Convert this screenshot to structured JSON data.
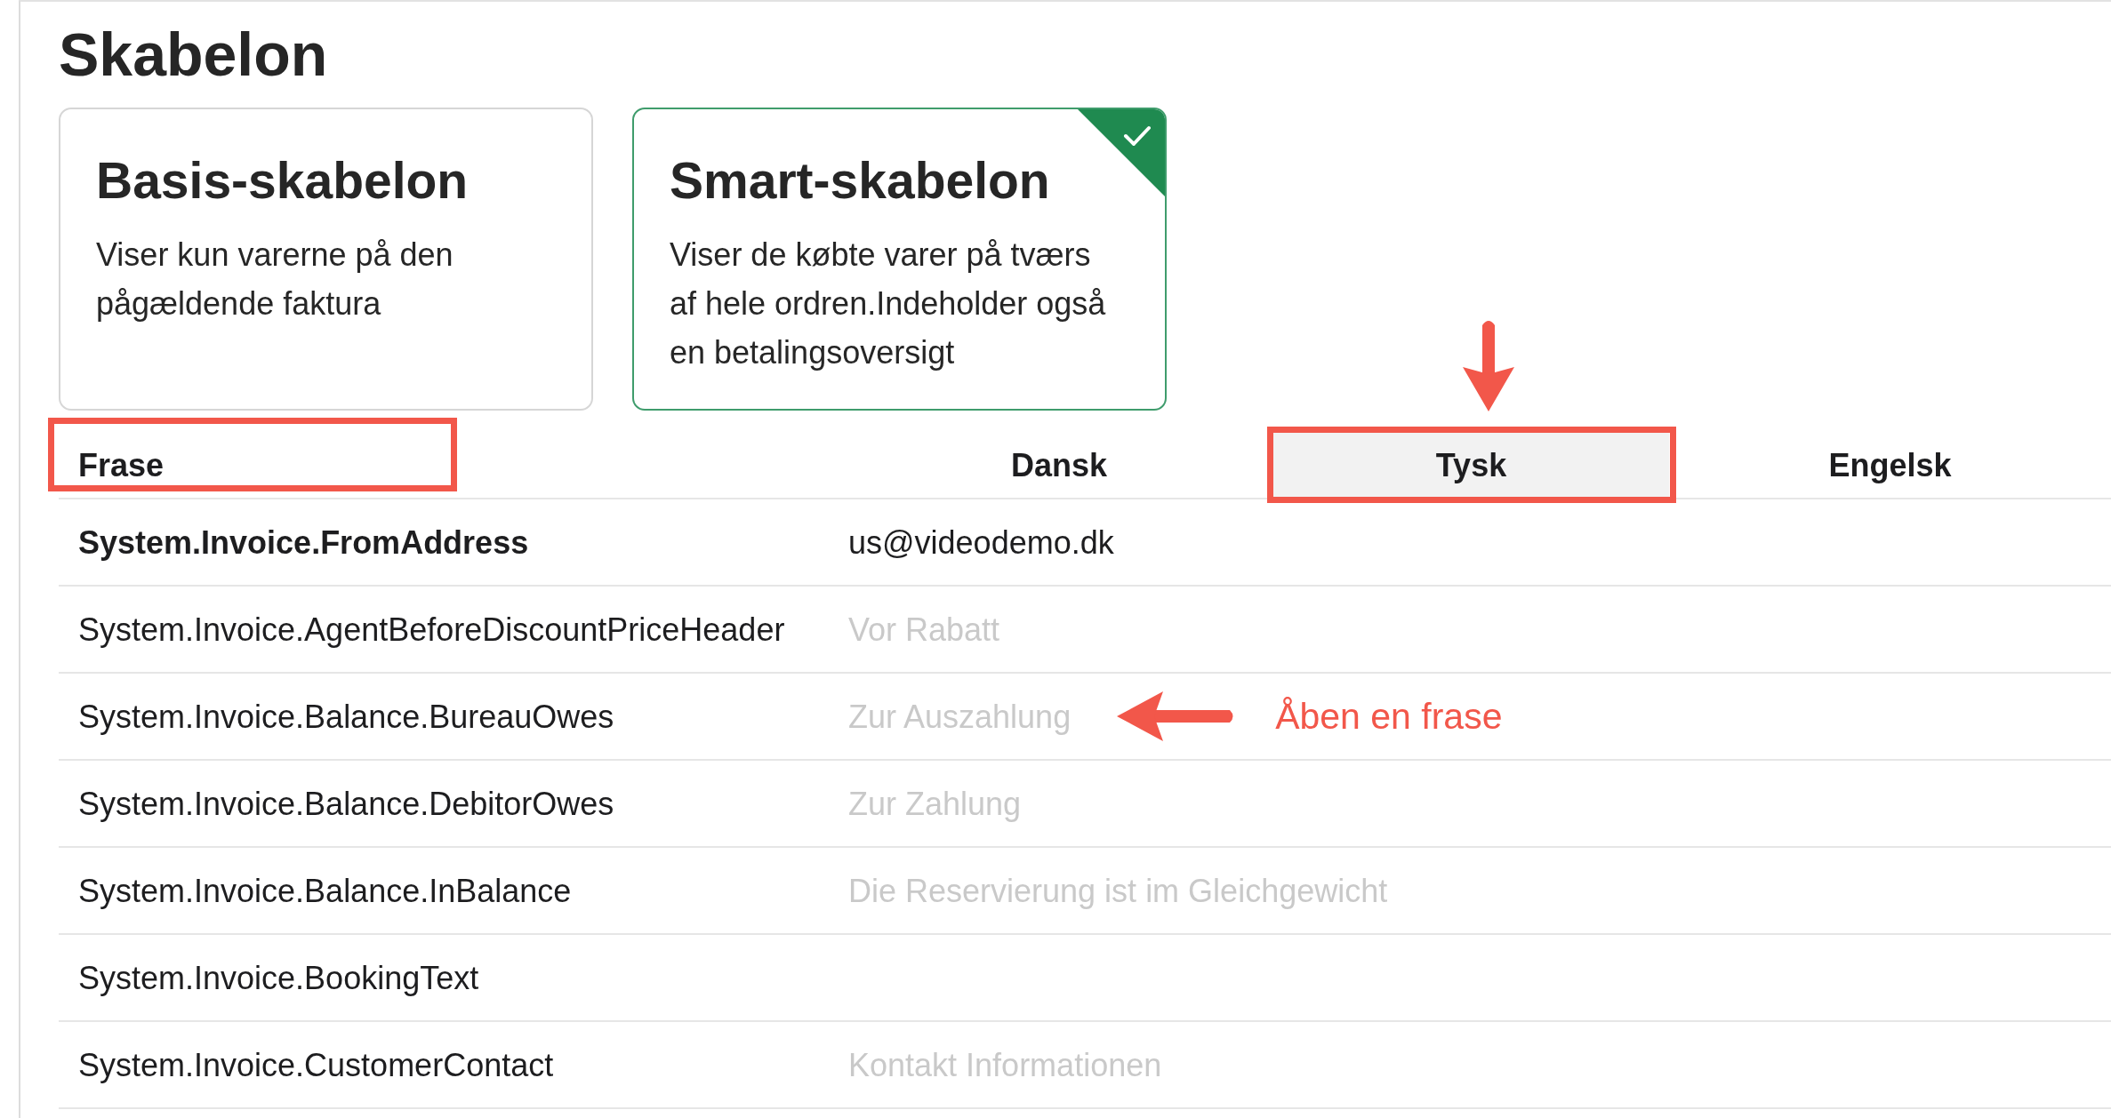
{
  "page": {
    "title": "Skabelon"
  },
  "cards": [
    {
      "title": "Basis-skabelon",
      "description": "Viser kun varerne på den pågældende faktura",
      "selected": false
    },
    {
      "title": "Smart-skabelon",
      "description": "Viser de købte varer på tværs af hele ordren.Indeholder også en betalingsoversigt",
      "selected": true
    }
  ],
  "table": {
    "columns": [
      {
        "label": "Frase",
        "selected": false,
        "outlined": true,
        "pointed": false
      },
      {
        "label": "Dansk",
        "selected": false,
        "outlined": false,
        "pointed": false
      },
      {
        "label": "Tysk",
        "selected": true,
        "outlined": true,
        "pointed": true
      },
      {
        "label": "Engelsk",
        "selected": false,
        "outlined": false,
        "pointed": false
      }
    ],
    "rows": [
      {
        "phrase": "System.Invoice.FromAddress",
        "bold": true,
        "value": "us@videodemo.dk",
        "dimmed": false
      },
      {
        "phrase": "System.Invoice.AgentBeforeDiscountPriceHeader",
        "bold": false,
        "value": "Vor Rabatt",
        "dimmed": true
      },
      {
        "phrase": "System.Invoice.Balance.BureauOwes",
        "bold": false,
        "value": "Zur Auszahlung",
        "dimmed": true,
        "callout": "Åben en frase"
      },
      {
        "phrase": "System.Invoice.Balance.DebitorOwes",
        "bold": false,
        "value": "Zur Zahlung",
        "dimmed": true
      },
      {
        "phrase": "System.Invoice.Balance.InBalance",
        "bold": false,
        "value": "Die Reservierung ist im Gleichgewicht",
        "dimmed": true
      },
      {
        "phrase": "System.Invoice.BookingText",
        "bold": false
      },
      {
        "phrase": "System.Invoice.CustomerContact",
        "bold": false,
        "value": "Kontakt Informationen",
        "dimmed": true
      }
    ]
  }
}
